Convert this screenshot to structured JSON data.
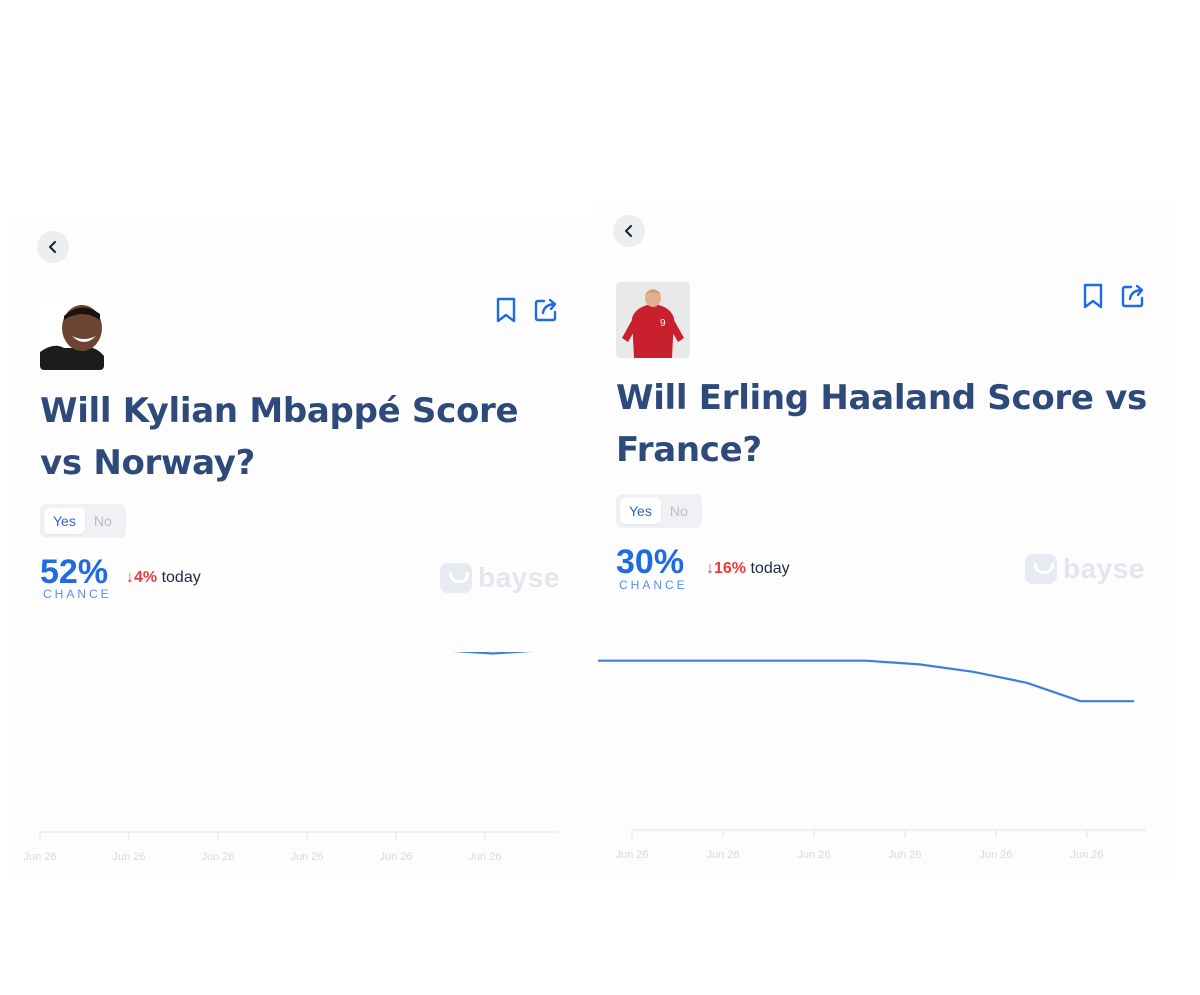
{
  "panels": [
    {
      "question": "Will Kylian Mbappé Score vs Norway?",
      "options": [
        "Yes",
        "No"
      ],
      "selected_option": "Yes",
      "probability": "52%",
      "probability_label": "CHANCE",
      "change": "↓4%",
      "change_period": "today",
      "brand": "bayse",
      "icons": {
        "back": "chevron-left-icon",
        "bookmark": "bookmark-icon",
        "share": "share-icon"
      },
      "colors": {
        "title": "#2e4a7a",
        "probability": "#1f6be3",
        "change": "#e53b3b",
        "line": "#3d7fdc"
      },
      "chart_data": {
        "type": "line",
        "x": [
          "Jun 26",
          "Jun 26",
          "Jun 26",
          "Jun 26",
          "Jun 26",
          "Jun 26"
        ],
        "series": [
          {
            "values": [
              53,
              52,
              52,
              52,
              52,
              52,
              52,
              52,
              52,
              51,
              52
            ]
          }
        ],
        "ylim": [
          0,
          100
        ],
        "grid": false
      }
    },
    {
      "question": "Will Erling Haaland Score vs France?",
      "options": [
        "Yes",
        "No"
      ],
      "selected_option": "Yes",
      "probability": "30%",
      "probability_label": "CHANCE",
      "change": "↓16%",
      "change_period": "today",
      "brand": "bayse",
      "icons": {
        "back": "chevron-left-icon",
        "bookmark": "bookmark-icon",
        "share": "share-icon"
      },
      "colors": {
        "title": "#2e4a7a",
        "probability": "#1f6be3",
        "change": "#e53b3b",
        "line": "#3d7fdc"
      },
      "chart_data": {
        "type": "line",
        "x": [
          "Jun 26",
          "Jun 26",
          "Jun 26",
          "Jun 26",
          "Jun 26",
          "Jun 26"
        ],
        "series": [
          {
            "values": [
              46,
              46,
              46,
              46,
              46,
              46,
              45,
              43,
              40,
              35,
              35
            ]
          }
        ],
        "ylim": [
          0,
          100
        ],
        "grid": false
      }
    }
  ]
}
